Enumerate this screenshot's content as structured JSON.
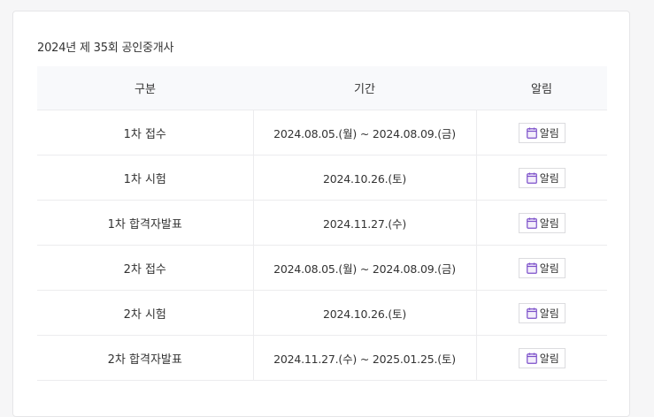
{
  "title": "2024년 제 35회 공인중개사",
  "headers": {
    "type": "구분",
    "period": "기간",
    "alarm": "알림"
  },
  "rows": [
    {
      "type": "1차 접수",
      "period": "2024.08.05.(월) ~ 2024.08.09.(금)",
      "alarm_label": "알림"
    },
    {
      "type": "1차 시험",
      "period": "2024.10.26.(토)",
      "alarm_label": "알림"
    },
    {
      "type": "1차 합격자발표",
      "period": "2024.11.27.(수)",
      "alarm_label": "알림"
    },
    {
      "type": "2차 접수",
      "period": "2024.08.05.(월) ~ 2024.08.09.(금)",
      "alarm_label": "알림"
    },
    {
      "type": "2차 시험",
      "period": "2024.10.26.(토)",
      "alarm_label": "알림"
    },
    {
      "type": "2차 합격자발표",
      "period": "2024.11.27.(수) ~ 2025.01.25.(토)",
      "alarm_label": "알림"
    }
  ],
  "icons": {
    "alarm_icon": "calendar-icon"
  },
  "colors": {
    "icon_accent": "#7b4fc9",
    "header_bg": "#f8f9fb",
    "border": "#ececee"
  }
}
